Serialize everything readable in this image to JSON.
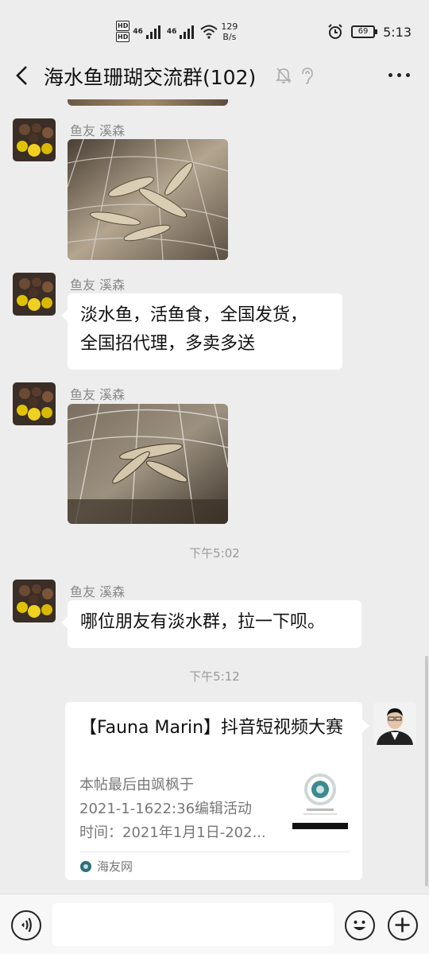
{
  "status": {
    "network": "46",
    "network2": "46",
    "speed_value": "129",
    "speed_unit": "B/s",
    "battery": "69",
    "clock": "5:13"
  },
  "header": {
    "title": "海水鱼珊瑚交流群(102)"
  },
  "messages": [
    {
      "name": "鱼友 溪森"
    },
    {
      "name": "鱼友 溪森",
      "text_line1": "淡水鱼，活鱼食，全国发货，",
      "text_line2": "全国招代理，多卖多送"
    },
    {
      "name": "鱼友 溪森"
    },
    {
      "name": "鱼友 溪森",
      "text": "哪位朋友有淡水群，拉一下呗。"
    }
  ],
  "timestamps": [
    "下午5:02",
    "下午5:12"
  ],
  "card": {
    "title": "【Fauna Marin】抖音短视频大赛",
    "desc_line1": "本帖最后由飒枫于",
    "desc_line2": "2021-1-1622:36编辑活动",
    "desc_line3": "时间：2021年1月1日-202...",
    "source": "海友网"
  },
  "icons": {
    "back": "chevron-left-icon",
    "mute": "bell-off-icon",
    "ear": "ear-icon",
    "more": "more-icon",
    "voice": "voice-icon",
    "emoji": "emoji-icon",
    "plus": "plus-icon"
  }
}
